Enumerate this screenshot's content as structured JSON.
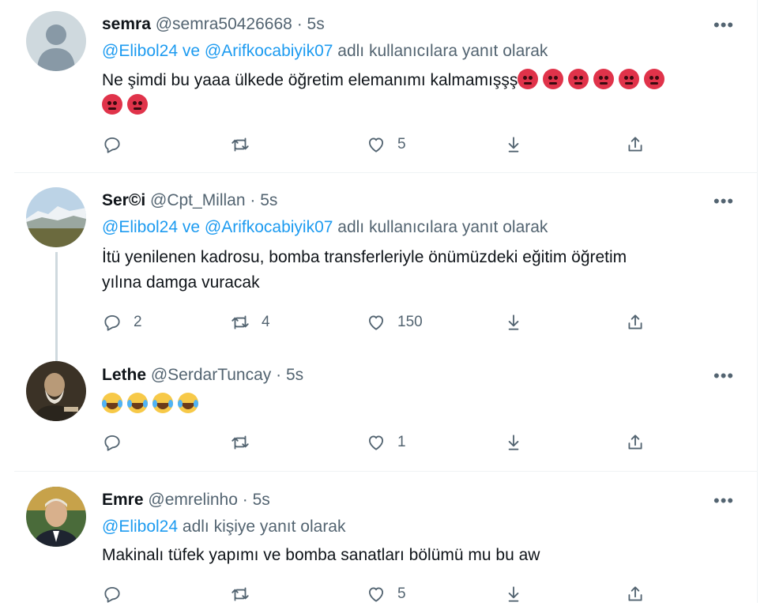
{
  "tweets": [
    {
      "name": "semra",
      "handle": "@semra50426668",
      "time": "5s",
      "reply_mentions": "@Elibol24 ve @Arifkocabiyik07",
      "reply_suffix": "adlı kullanıcılara yanıt olarak",
      "text": "Ne şimdi bu yaaa ülkede öğretim elemanımı kalmamışşş",
      "emoji": "angry-face x8",
      "counts": {
        "reply": "",
        "retweet": "",
        "like": "5"
      }
    },
    {
      "name": "Ser©i",
      "handle": "@Cpt_Millan",
      "time": "5s",
      "reply_mentions": "@Elibol24 ve @Arifkocabiyik07",
      "reply_suffix": "adlı kullanıcılara yanıt olarak",
      "text_line1": "İtü yenilenen kadrosu, bomba transferleriyle önümüzdeki eğitim öğretim",
      "text_line2": "yılına damga vuracak",
      "counts": {
        "reply": "2",
        "retweet": "4",
        "like": "150"
      }
    },
    {
      "name": "Lethe",
      "handle": "@SerdarTuncay",
      "time": "5s",
      "emoji": "tears-of-joy x4",
      "counts": {
        "reply": "",
        "retweet": "",
        "like": "1"
      }
    },
    {
      "name": "Emre",
      "handle": "@emrelinho",
      "time": "5s",
      "reply_mentions": "@Elibol24",
      "reply_suffix": "adlı kişiye yanıt olarak",
      "text": "Makinalı tüfek yapımı ve bomba sanatları bölümü mu bu aw",
      "counts": {
        "reply": "",
        "retweet": "",
        "like": "5"
      }
    }
  ],
  "ui": {
    "dot": "·",
    "more": "•••"
  },
  "icons": [
    "reply-icon",
    "retweet-icon",
    "like-icon",
    "download-icon",
    "share-icon",
    "more-icon"
  ],
  "colors": {
    "link": "#1d9bf0",
    "muted": "#536471",
    "text": "#0f1419",
    "divider": "#eff3f4"
  }
}
